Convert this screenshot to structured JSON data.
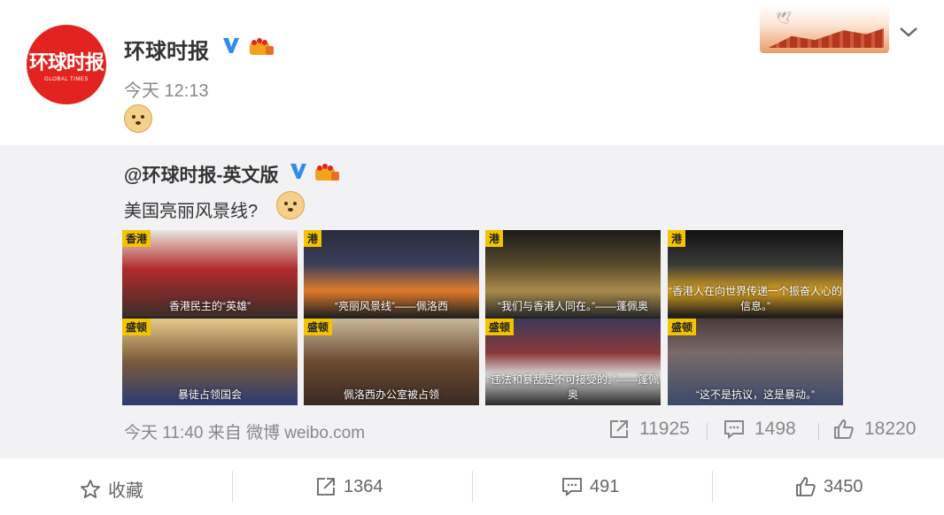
{
  "post": {
    "avatar_text_cn": "环球时报",
    "avatar_text_en": "GLOBAL TIMES",
    "username": "环球时报",
    "timestamp": "今天 12:13",
    "body_emoji": "doge-emoji"
  },
  "repost": {
    "username": "@环球时报-英文版",
    "text": "美国亮丽风景线?",
    "images": [
      {
        "top_tag": "香港",
        "top_caption": "香港民主的“英雄”",
        "bottom_tag": "盛顿",
        "bottom_caption": "暴徒占领国会"
      },
      {
        "top_tag": "港",
        "top_caption": "“亮丽风景线”——佩洛西",
        "bottom_tag": "盛顿",
        "bottom_caption": "佩洛西办公室被占领"
      },
      {
        "top_tag": "港",
        "top_caption": "“我们与香港人同在。”——蓬佩奥",
        "bottom_tag": "盛顿",
        "bottom_caption": "“违法和暴乱是不可接受的。”——蓬佩奥"
      },
      {
        "top_tag": "港",
        "top_caption": "“香港人在向世界传递一个振奋人心的信息。”",
        "bottom_tag": "盛顿",
        "bottom_caption": "“这不是抗议，这是暴动。”"
      }
    ],
    "footer": "今天 11:40 来自 微博 weibo.com",
    "shares": "11925",
    "comments": "1498",
    "likes": "18220"
  },
  "actions": {
    "favorite_label": "收藏",
    "share_count": "1364",
    "comment_count": "491",
    "like_count": "3450"
  },
  "colors": {
    "brand_red": "#e3231f",
    "tag_yellow": "#f5c400",
    "verified_blue": "#2d8ef0"
  }
}
